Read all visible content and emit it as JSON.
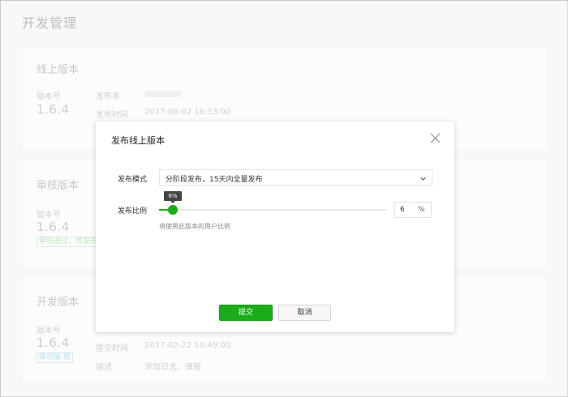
{
  "page": {
    "title": "开发管理"
  },
  "sections": {
    "online": {
      "title": "线上版本",
      "version_label": "版本号",
      "version": "1.6.4",
      "publisher_label": "发布者",
      "time_label": "发布时间",
      "time": "2017-08-02 16:53:00"
    },
    "review": {
      "title": "审核版本",
      "version_label": "版本号",
      "version": "1.6.4",
      "status": "审核通过，待发布"
    },
    "dev": {
      "title": "开发版本",
      "version_label": "版本号",
      "version": "1.6.4",
      "status": "体验版 跑",
      "submit_time_label": "提交时间",
      "submit_time": "2017-02-22 10:49:00",
      "desc_label": "描述",
      "desc": "添加日志、弹窗"
    }
  },
  "dialog": {
    "title": "发布线上版本",
    "mode_label": "发布模式",
    "mode_value": "分阶段发布，15天内全量发布",
    "ratio_label": "发布比例",
    "ratio_percent": 6,
    "ratio_tooltip": "6%",
    "ratio_input_value": "6",
    "ratio_unit": "%",
    "hint": "将使用此版本的用户比例",
    "submit_label": "提交",
    "cancel_label": "取消"
  },
  "colors": {
    "primary": "#1aad19",
    "tooltip": "#444444",
    "tag_green": "#9fd8a6",
    "tag_blue": "#8ed0e6"
  },
  "icons": {
    "close": "close-icon",
    "dropdown": "chevron-down-icon"
  }
}
